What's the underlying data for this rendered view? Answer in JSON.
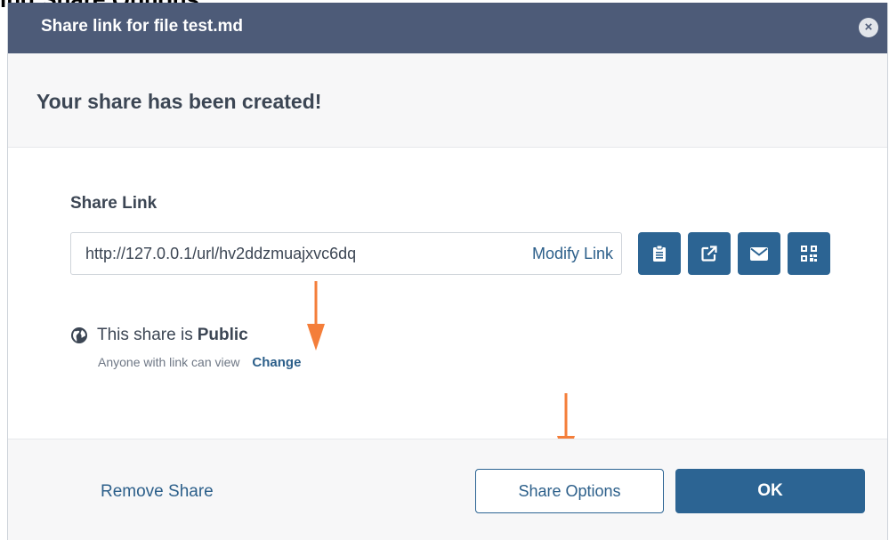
{
  "top_clipped_text": "ing Share Options",
  "dialog": {
    "title": "Share link for file test.md",
    "close_glyph": "×",
    "success_message": "Your share has been created!"
  },
  "share_link": {
    "label": "Share Link",
    "url": "http://127.0.0.1/url/hv2ddzmuajxvc6dq",
    "modify_label": "Modify Link",
    "action_icons": [
      "clipboard-icon",
      "external-link-icon",
      "envelope-icon",
      "qr-code-icon"
    ]
  },
  "visibility": {
    "prefix": "This share is",
    "status": "Public",
    "description": "Anyone with link can view",
    "change_label": "Change"
  },
  "footer": {
    "remove_label": "Remove Share",
    "options_label": "Share Options",
    "ok_label": "OK"
  },
  "colors": {
    "titlebar": "#4d5b78",
    "primary_button": "#2c6493",
    "annotation_arrow": "#f47e3a"
  }
}
